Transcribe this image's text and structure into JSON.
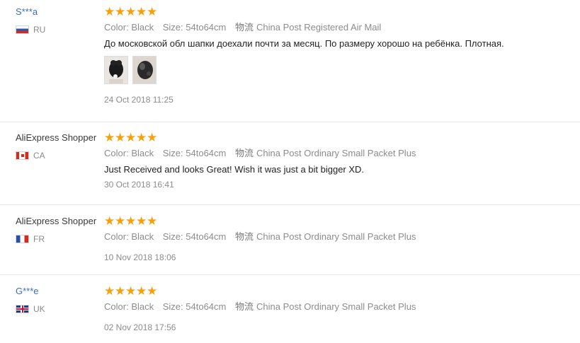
{
  "reviews": [
    {
      "name": "S***a",
      "name_is_link": true,
      "country": "RU",
      "rating": 5,
      "color_label": "Color:",
      "color_value": "Black",
      "size_label": "Size:",
      "size_value": "54to64cm",
      "shipping_label": "物流",
      "shipping_value": "China Post Registered Air Mail",
      "feedback": "До московской обл шапки доехали почти за месяц. По размеру хорошо на ребёнка. Плотная.",
      "photos": [
        "review-photo-1",
        "review-photo-2"
      ],
      "date": "24 Oct 2018 11:25"
    },
    {
      "name": "AliExpress Shopper",
      "name_is_link": false,
      "country": "CA",
      "rating": 5,
      "color_label": "Color:",
      "color_value": "Black",
      "size_label": "Size:",
      "size_value": "54to64cm",
      "shipping_label": "物流",
      "shipping_value": "China Post Ordinary Small Packet Plus",
      "feedback": "Just Received and looks Great! Wish it was just a bit bigger XD.",
      "date": "30 Oct 2018 16:41"
    },
    {
      "name": "AliExpress Shopper",
      "name_is_link": false,
      "country": "FR",
      "rating": 5,
      "color_label": "Color:",
      "color_value": "Black",
      "size_label": "Size:",
      "size_value": "54to64cm",
      "shipping_label": "物流",
      "shipping_value": "China Post Ordinary Small Packet Plus",
      "date": "10 Nov 2018 18:06"
    },
    {
      "name": "G***e",
      "name_is_link": true,
      "country": "UK",
      "rating": 5,
      "color_label": "Color:",
      "color_value": "Black",
      "size_label": "Size:",
      "size_value": "54to64cm",
      "shipping_label": "物流",
      "shipping_value": "China Post Ordinary Small Packet Plus",
      "date": "02 Nov 2018 17:56"
    }
  ],
  "colors": {
    "star": "#f6a10c",
    "link_name": "#3b6fb6",
    "muted_text": "#8c8c8c",
    "divider": "#e8e8e8"
  }
}
